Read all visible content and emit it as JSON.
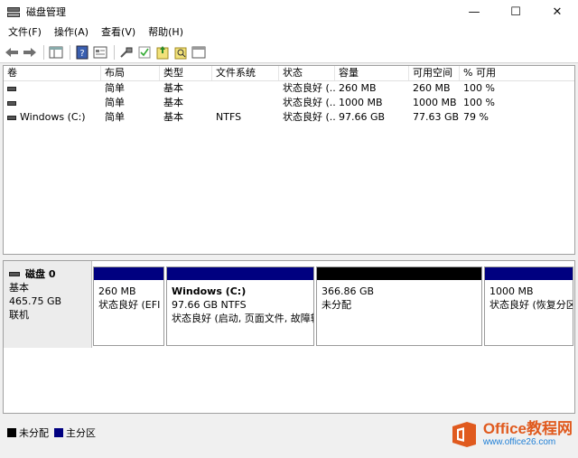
{
  "window": {
    "title": "磁盘管理",
    "minimize": "—",
    "maximize": "☐",
    "close": "✕"
  },
  "menu": [
    "文件(F)",
    "操作(A)",
    "查看(V)",
    "帮助(H)"
  ],
  "toolbar": [
    "back-icon",
    "forward-icon",
    "console-tree-icon",
    "help-icon",
    "properties-icon",
    "connect-icon",
    "check-icon",
    "refresh-icon",
    "search-icon",
    "window-icon"
  ],
  "list": {
    "columns": [
      "卷",
      "布局",
      "类型",
      "文件系统",
      "状态",
      "容量",
      "可用空间",
      "% 可用"
    ],
    "rows": [
      [
        "",
        "简单",
        "基本",
        "",
        "状态良好 (...",
        "260 MB",
        "260 MB",
        "100 %"
      ],
      [
        "",
        "简单",
        "基本",
        "",
        "状态良好 (...",
        "1000 MB",
        "1000 MB",
        "100 %"
      ],
      [
        "Windows (C:)",
        "简单",
        "基本",
        "NTFS",
        "状态良好 (...",
        "97.66 GB",
        "77.63 GB",
        "79 %"
      ]
    ]
  },
  "disk": {
    "name": "磁盘 0",
    "type": "基本",
    "size": "465.75 GB",
    "status": "联机",
    "partitions": [
      {
        "title": "",
        "size": "260 MB",
        "status": "状态良好 (EFI 系",
        "color": "#000080"
      },
      {
        "title": "Windows  (C:)",
        "size": "97.66 GB NTFS",
        "status": "状态良好 (启动, 页面文件, 故障转",
        "color": "#000080"
      },
      {
        "title": "",
        "size": "366.86 GB",
        "status": "未分配",
        "color": "#000000"
      },
      {
        "title": "",
        "size": "1000 MB",
        "status": "状态良好 (恢复分区",
        "color": "#000080"
      }
    ]
  },
  "legend": [
    {
      "label": "未分配",
      "color": "#000000"
    },
    {
      "label": "主分区",
      "color": "#000080"
    }
  ],
  "watermark": {
    "brand": "Office教程网",
    "url": "www.office26.com",
    "logo_color": "#e05a1e"
  }
}
